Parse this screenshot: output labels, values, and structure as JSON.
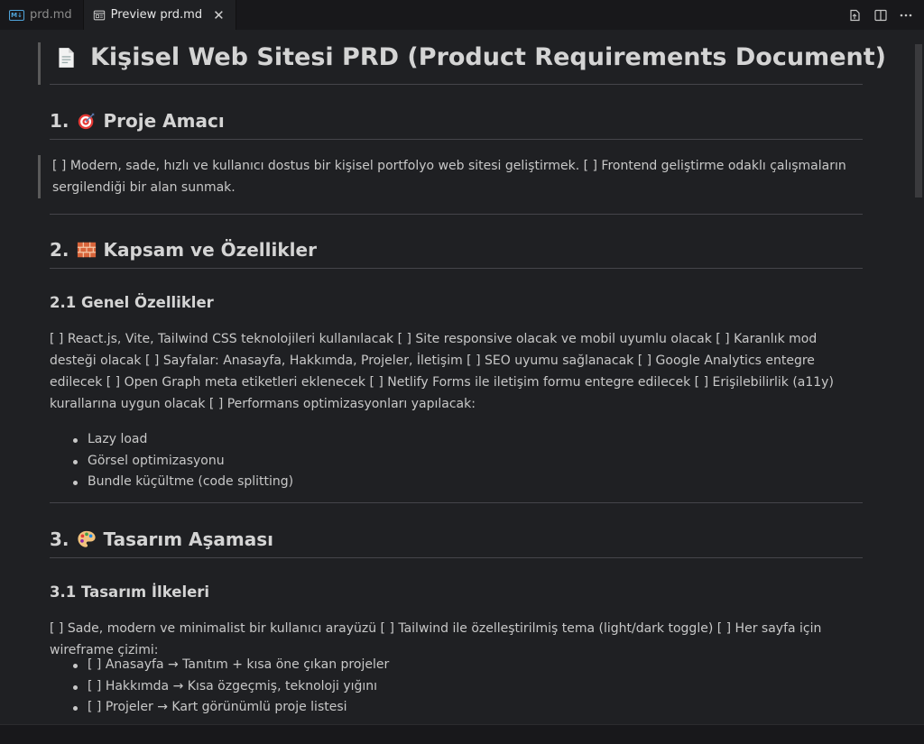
{
  "tabs": [
    {
      "icon": "markdown-icon",
      "badge": "M↓",
      "label": "prd.md",
      "active": false
    },
    {
      "icon": "preview-icon",
      "label": "Preview prd.md",
      "active": true,
      "close": "✕"
    }
  ],
  "actions": [
    "open-source-icon",
    "split-editor-icon",
    "more-icon"
  ],
  "doc": {
    "title": "Kişisel Web Sitesi PRD (Product Requirements Document)",
    "s1": {
      "num": "1.",
      "title": "Proje Amacı",
      "quote": "[ ] Modern, sade, hızlı ve kullanıcı dostus bir kişisel portfolyo web sitesi geliştirmek. [ ] Frontend geliştirme odaklı çalışmaların sergilendiği bir alan sunmak."
    },
    "s2": {
      "num": "2.",
      "title": "Kapsam ve Özellikler",
      "sub": "2.1 Genel Özellikler",
      "para": "[ ] React.js, Vite, Tailwind CSS teknolojileri kullanılacak [ ] Site responsive olacak ve mobil uyumlu olacak [ ] Karanlık mod desteği olacak [ ] Sayfalar: Anasayfa, Hakkımda, Projeler, İletişim [ ] SEO uyumu sağlanacak [ ] Google Analytics entegre edilecek [ ] Open Graph meta etiketleri eklenecek [ ] Netlify Forms ile iletişim formu entegre edilecek [ ] Erişilebilirlik (a11y) kurallarına uygun olacak [ ] Performans optimizasyonları yapılacak:",
      "items": [
        "Lazy load",
        "Görsel optimizasyonu",
        "Bundle küçültme (code splitting)"
      ]
    },
    "s3": {
      "num": "3.",
      "title": "Tasarım Aşaması",
      "sub": "3.1 Tasarım İlkeleri",
      "para": "[ ] Sade, modern ve minimalist bir kullanıcı arayüzü [ ] Tailwind ile özelleştirilmiş tema (light/dark toggle) [ ] Her sayfa için wireframe çizimi:",
      "items": [
        "[ ] Anasayfa → Tanıtım + kısa öne çıkan projeler",
        "[ ] Hakkımda → Kısa özgeçmiş, teknoloji yığını",
        "[ ] Projeler → Kart görünümlü proje listesi"
      ]
    }
  }
}
